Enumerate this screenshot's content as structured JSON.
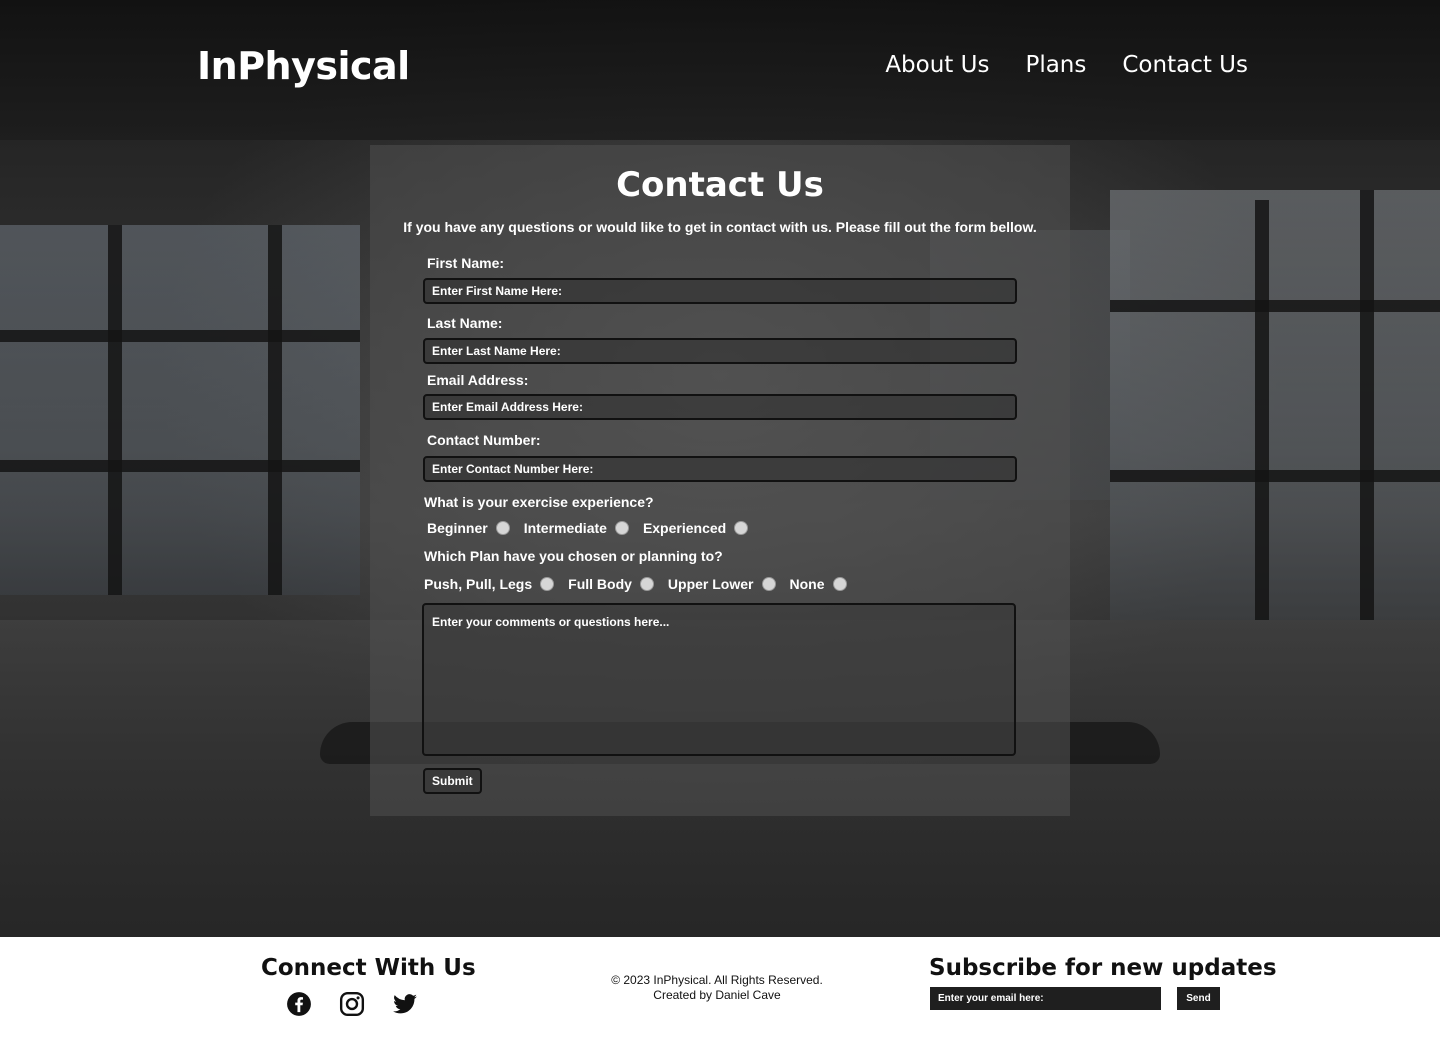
{
  "header": {
    "logo": "InPhysical",
    "nav": [
      "About Us",
      "Plans",
      "Contact Us"
    ]
  },
  "form": {
    "title": "Contact Us",
    "intro": "If you have any questions or would like to get in contact with us. Please fill out the form bellow.",
    "first_name": {
      "label": "First Name:",
      "placeholder": "Enter First Name Here:",
      "value": ""
    },
    "last_name": {
      "label": "Last Name:",
      "placeholder": "Enter Last Name Here:",
      "value": ""
    },
    "email": {
      "label": "Email Address:",
      "placeholder": "Enter Email Address Here:",
      "value": ""
    },
    "contact": {
      "label": "Contact Number:",
      "placeholder": "Enter Contact Number Here:",
      "value": ""
    },
    "experience": {
      "question": "What is your exercise experience?",
      "options": [
        "Beginner",
        "Intermediate",
        "Experienced"
      ]
    },
    "plan": {
      "question": "Which Plan have you chosen or planning to?",
      "options": [
        "Push, Pull, Legs",
        "Full Body",
        "Upper Lower",
        "None"
      ]
    },
    "comments": {
      "placeholder": "Enter your comments or questions here...",
      "value": ""
    },
    "submit_label": "Submit"
  },
  "footer": {
    "connect_title": "Connect With Us",
    "social_icons": [
      "facebook-icon",
      "instagram-icon",
      "twitter-icon"
    ],
    "copyright_line1": "© 2023 InPhysical. All Rights Reserved.",
    "copyright_line2": "Created by Daniel Cave",
    "subscribe_title": "Subscribe for new updates",
    "subscribe_placeholder": "Enter your email here:",
    "send_label": "Send"
  }
}
